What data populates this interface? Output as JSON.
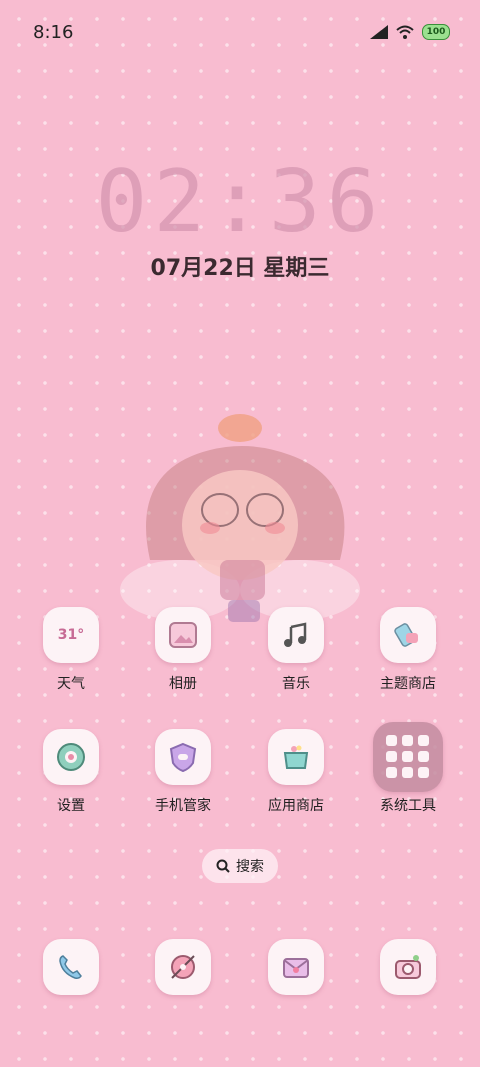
{
  "status_bar": {
    "time": "8:16",
    "battery": "100"
  },
  "lock": {
    "clock": "02:36",
    "date": "07月22日 星期三"
  },
  "apps_row1": [
    {
      "label": "天气",
      "icon": "weather-icon",
      "icon_text": "31°"
    },
    {
      "label": "相册",
      "icon": "gallery-icon"
    },
    {
      "label": "音乐",
      "icon": "music-icon"
    },
    {
      "label": "主题商店",
      "icon": "theme-store-icon"
    }
  ],
  "apps_row2": [
    {
      "label": "设置",
      "icon": "settings-icon"
    },
    {
      "label": "手机管家",
      "icon": "phone-manager-icon"
    },
    {
      "label": "应用商店",
      "icon": "app-store-icon"
    },
    {
      "label": "系统工具",
      "icon": "system-tools-folder-icon"
    }
  ],
  "search": {
    "label": "搜索"
  },
  "dock": [
    {
      "icon": "phone-icon"
    },
    {
      "icon": "browser-icon"
    },
    {
      "icon": "messages-icon"
    },
    {
      "icon": "camera-icon"
    }
  ],
  "colors": {
    "background": "#f8bcd0",
    "icon_bg": "#fdf3f6",
    "accent": "#c76b95"
  }
}
